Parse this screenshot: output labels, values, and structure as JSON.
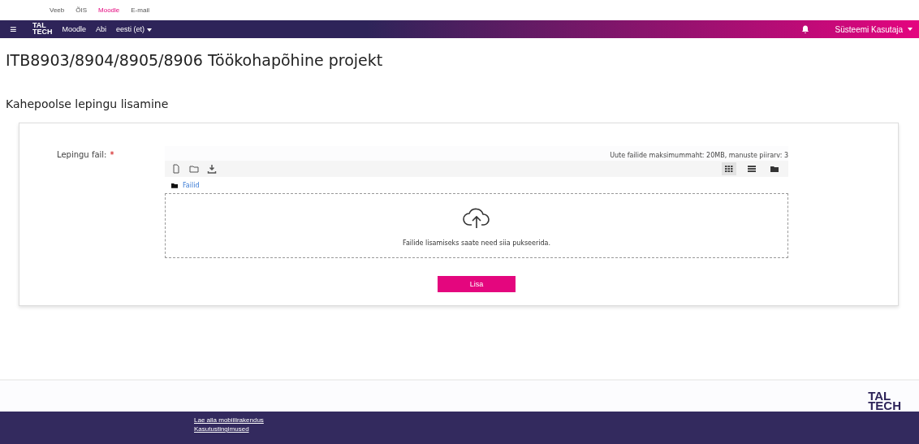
{
  "top_links": [
    {
      "label": "Veeb",
      "selected": false
    },
    {
      "label": "ÕIS",
      "selected": false
    },
    {
      "label": "Moodle",
      "selected": true
    },
    {
      "label": "E-mail",
      "selected": false
    }
  ],
  "navbar": {
    "menu_glyph": "≡",
    "logo": [
      "TAL",
      "TECH"
    ],
    "items": [
      "Moodle",
      "Abi"
    ],
    "language": "eesti (et)",
    "user": "Süsteemi Kasutaja"
  },
  "page_title": "ITB8903/8904/8905/8906 Töökohapõhine projekt",
  "section_title": "Kahepoolse lepingu lisamine",
  "form": {
    "label": "Lepingu fail:",
    "required_mark": "*",
    "limits": "Uute failide maksimummaht: 20MB, manuste piirarv: 3",
    "views": [
      {
        "kind": "icons",
        "selected": true
      },
      {
        "kind": "list",
        "selected": false
      },
      {
        "kind": "tree",
        "selected": false
      }
    ],
    "folder": "Failid",
    "drop_text": "Failide lisamiseks saate need siia pukseerida.",
    "submit": "Lisa"
  },
  "footer": {
    "logo": [
      "TAL",
      "TECH"
    ],
    "links": [
      "Lae alla mobiilirakendus",
      "Kasutustingimused"
    ]
  }
}
